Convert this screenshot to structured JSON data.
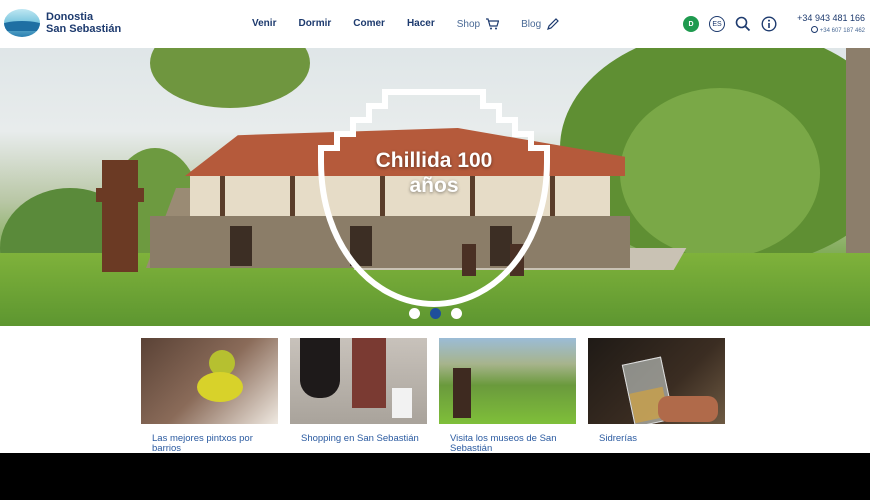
{
  "brand": {
    "line1": "Donostia",
    "line2": "San Sebastián"
  },
  "nav": {
    "items": [
      "Venir",
      "Dormir",
      "Comer",
      "Hacer"
    ],
    "shop": "Shop",
    "blog": "Blog"
  },
  "tools": {
    "lang_badge": "D",
    "lang_code": "ES"
  },
  "contact": {
    "phone": "+34 943 481 166",
    "whatsapp": "+34 607 187 462"
  },
  "hero": {
    "title_line1": "Chillida 100",
    "title_line2": "años",
    "slides": 3,
    "active_slide": 2
  },
  "cards": [
    {
      "label": "Las mejores pintxos por barrios"
    },
    {
      "label": "Shopping en San Sebastián"
    },
    {
      "label": "Visita los museos de San Sebastián"
    },
    {
      "label": "Sidrerías"
    }
  ],
  "colors": {
    "primary": "#1d3a6e",
    "accent_green": "#1f9a4f",
    "dot_active": "#1f4f9a"
  }
}
